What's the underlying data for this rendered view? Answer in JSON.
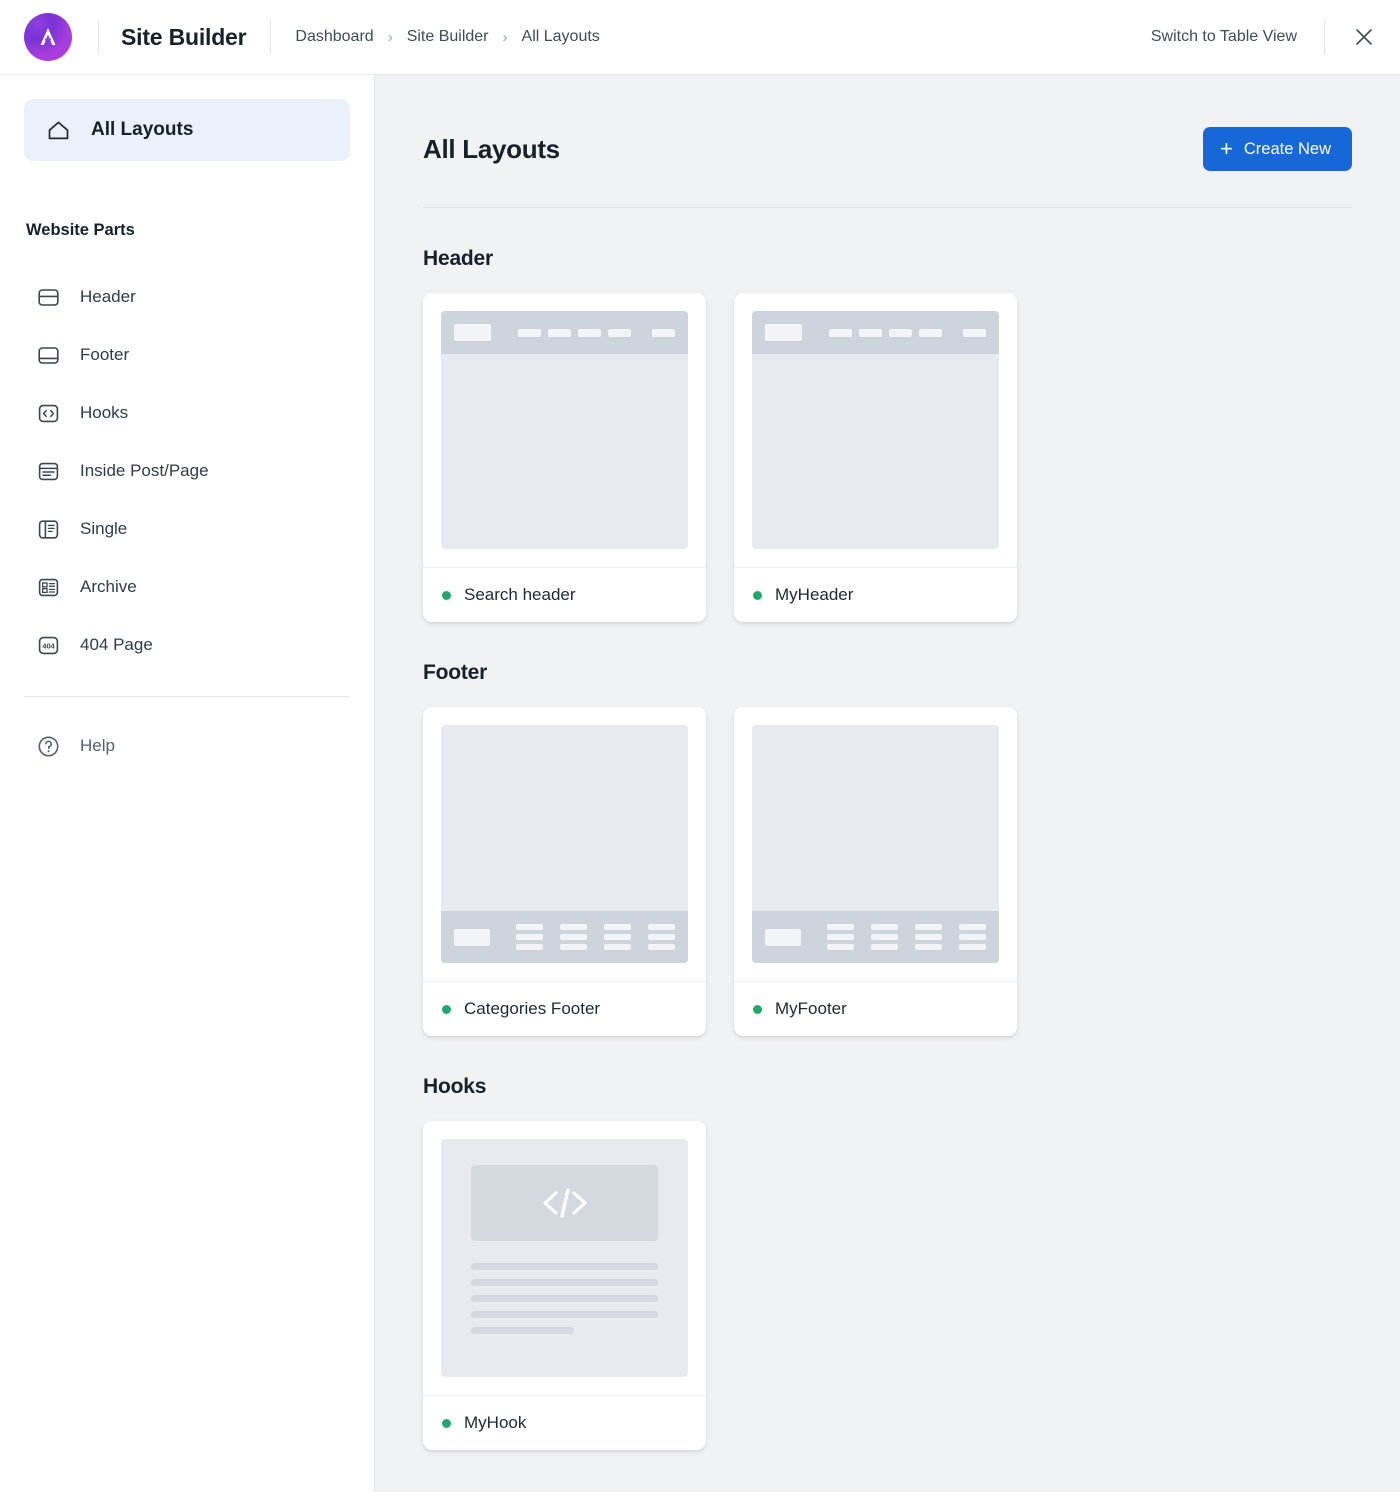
{
  "header": {
    "logo_icon": "app-logo-a-icon",
    "app_title": "Site Builder",
    "breadcrumbs": [
      {
        "label": "Dashboard"
      },
      {
        "label": "Site Builder"
      },
      {
        "label": "All Layouts"
      }
    ],
    "breadcrumb_separator": "›",
    "switch_view_label": "Switch to Table View",
    "close_icon": "close-icon"
  },
  "sidebar": {
    "active_item": {
      "label": "All Layouts",
      "icon": "home-icon"
    },
    "section_label": "Website Parts",
    "items": [
      {
        "label": "Header",
        "icon": "header-layout-icon"
      },
      {
        "label": "Footer",
        "icon": "footer-layout-icon"
      },
      {
        "label": "Hooks",
        "icon": "code-brackets-icon"
      },
      {
        "label": "Inside Post/Page",
        "icon": "document-lines-icon"
      },
      {
        "label": "Single",
        "icon": "single-panel-icon"
      },
      {
        "label": "Archive",
        "icon": "archive-grid-icon"
      },
      {
        "label": "404 Page",
        "icon": "404-box-icon"
      }
    ],
    "help": {
      "label": "Help",
      "icon": "question-circle-icon"
    }
  },
  "main": {
    "page_title": "All Layouts",
    "create_button": {
      "label": "Create New",
      "icon": "plus-icon"
    },
    "sections": [
      {
        "title": "Header",
        "cards": [
          {
            "name": "Search header",
            "status": "active",
            "preview": "header"
          },
          {
            "name": "MyHeader",
            "status": "active",
            "preview": "header"
          }
        ]
      },
      {
        "title": "Footer",
        "cards": [
          {
            "name": "Categories Footer",
            "status": "active",
            "preview": "footer"
          },
          {
            "name": "MyFooter",
            "status": "active",
            "preview": "footer"
          }
        ]
      },
      {
        "title": "Hooks",
        "cards": [
          {
            "name": "MyHook",
            "status": "active",
            "preview": "hook"
          }
        ]
      }
    ]
  },
  "colors": {
    "accent_blue": "#1668d8",
    "active_nav_bg": "#eaf1fb",
    "status_green": "#22a96a",
    "canvas_gray": "#f1f2f3",
    "logo_purple": "#8e3fe0"
  }
}
